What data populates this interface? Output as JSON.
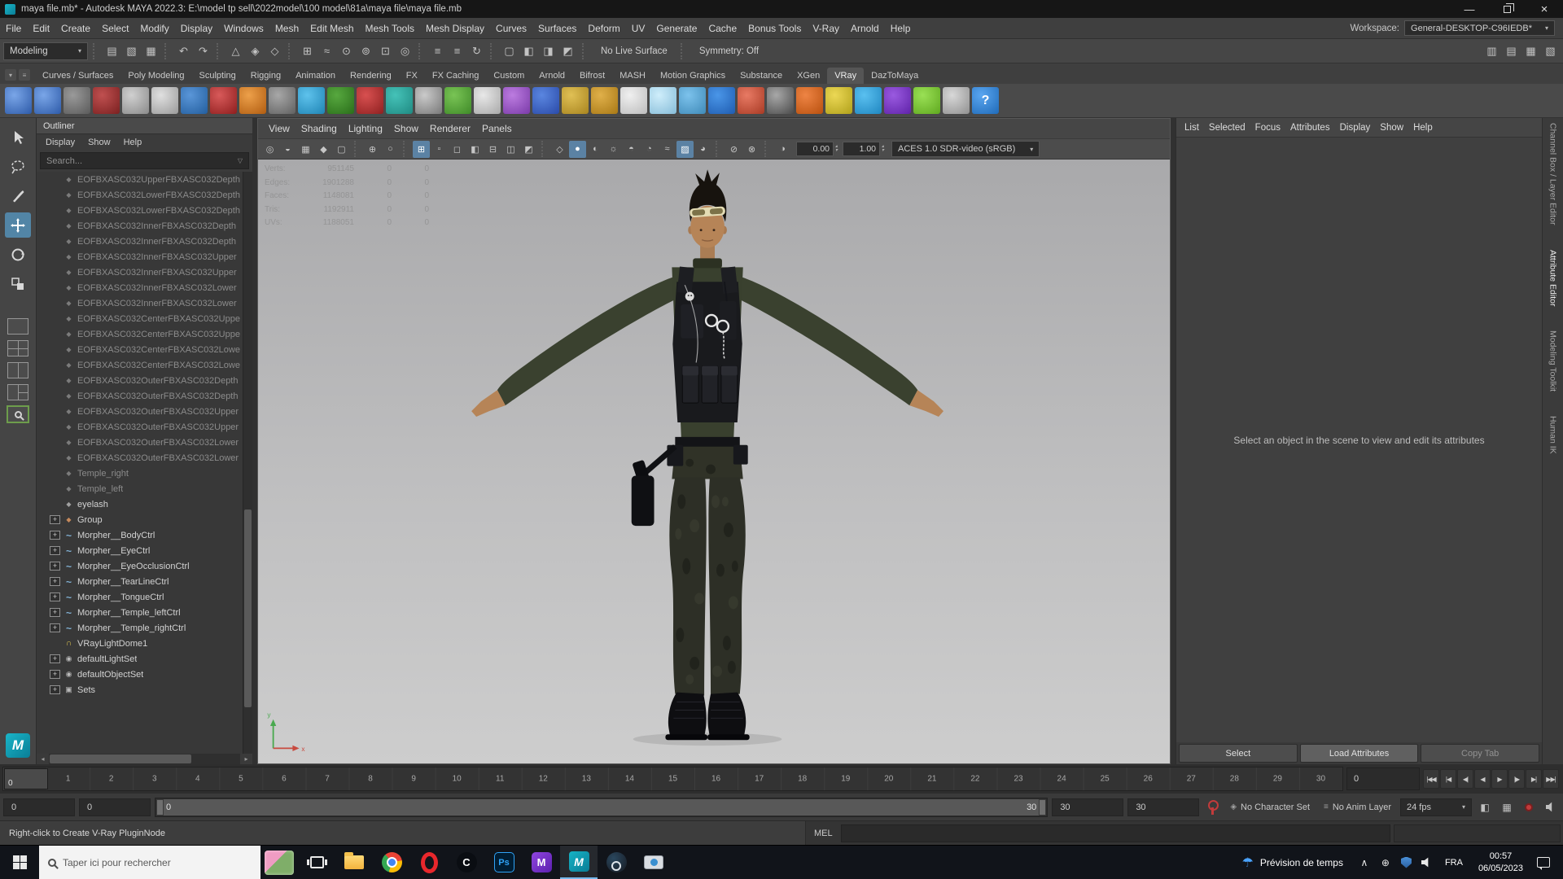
{
  "window": {
    "title": "maya file.mb* - Autodesk MAYA 2022.3: E:\\model tp sell\\2022model\\100 model\\81a\\maya file\\maya file.mb",
    "minimize": "—",
    "close": "×"
  },
  "menubar": {
    "items": [
      "File",
      "Edit",
      "Create",
      "Select",
      "Modify",
      "Display",
      "Windows",
      "Mesh",
      "Edit Mesh",
      "Mesh Tools",
      "Mesh Display",
      "Curves",
      "Surfaces",
      "Deform",
      "UV",
      "Generate",
      "Cache",
      "Bonus Tools",
      "V-Ray",
      "Arnold",
      "Help"
    ]
  },
  "workspace": {
    "label": "Workspace:",
    "value": "General-DESKTOP-C96IEDB*"
  },
  "toolbar": {
    "menuset": "Modeling",
    "no_live_surface": "No Live Surface",
    "symmetry": "Symmetry: Off",
    "icons": [
      {
        "sep": true
      },
      {
        "name": "file-new-icon",
        "glyph": "▤"
      },
      {
        "name": "file-open-icon",
        "glyph": "▧"
      },
      {
        "name": "file-save-icon",
        "glyph": "▦"
      },
      {
        "sep": true
      },
      {
        "name": "undo-icon",
        "glyph": "↶"
      },
      {
        "name": "redo-icon",
        "glyph": "↷"
      },
      {
        "sep": true
      },
      {
        "name": "select-hierarchy-icon",
        "glyph": "△"
      },
      {
        "name": "select-object-icon",
        "glyph": "◈"
      },
      {
        "name": "select-component-icon",
        "glyph": "◇"
      },
      {
        "sep": true
      },
      {
        "name": "snap-grid-icon",
        "glyph": "⊞"
      },
      {
        "name": "snap-curve-icon",
        "glyph": "≈"
      },
      {
        "name": "snap-point-icon",
        "glyph": "⊙"
      },
      {
        "name": "snap-projected-center-icon",
        "glyph": "⊚"
      },
      {
        "name": "snap-view-plane-icon",
        "glyph": "⊡"
      },
      {
        "name": "make-live-icon",
        "glyph": "◎"
      },
      {
        "sep": true
      },
      {
        "name": "input-connections-icon",
        "glyph": "≡"
      },
      {
        "name": "output-connections-icon",
        "glyph": "≡"
      },
      {
        "name": "construction-history-icon",
        "glyph": "↻"
      },
      {
        "sep": true
      },
      {
        "name": "render-view-icon",
        "glyph": "▢"
      },
      {
        "name": "render-current-frame-icon",
        "glyph": "◧"
      },
      {
        "name": "ipr-render-icon",
        "glyph": "◨"
      },
      {
        "name": "render-settings-icon",
        "glyph": "◩"
      }
    ],
    "right_icons": [
      {
        "name": "toggle-attribute-editor-icon",
        "glyph": "▥"
      },
      {
        "name": "toggle-tool-settings-icon",
        "glyph": "▤"
      },
      {
        "name": "toggle-channel-box-icon",
        "glyph": "▦"
      },
      {
        "name": "workspace-panel-icon",
        "glyph": "▧"
      }
    ]
  },
  "shelf": {
    "tabs": [
      "Curves / Surfaces",
      "Poly Modeling",
      "Sculpting",
      "Rigging",
      "Animation",
      "Rendering",
      "FX",
      "FX Caching",
      "Custom",
      "Arnold",
      "Bifrost",
      "MASH",
      "Motion Graphics",
      "Substance",
      "XGen",
      "VRay",
      "DazToMaya"
    ],
    "active_tab": "VRay",
    "icons": [
      {
        "name": "cv-curve-icon",
        "c1": "#7aa6e8",
        "c2": "#2d5aa8"
      },
      {
        "name": "ep-curve-icon",
        "c1": "#7aa6e8",
        "c2": "#2d5aa8"
      },
      {
        "name": "pencil-curve-icon",
        "c1": "#9a9a9a",
        "c2": "#5a5a5a"
      },
      {
        "name": "arc-tool-icon",
        "c1": "#c05050",
        "c2": "#7a2020"
      },
      {
        "name": "sphere-icon",
        "c1": "#d0d0d0",
        "c2": "#8a8a8a"
      },
      {
        "name": "cube-icon",
        "c1": "#e0e0e0",
        "c2": "#9a9a9a"
      },
      {
        "name": "character-icon",
        "c1": "#5a96d8",
        "c2": "#235e9e"
      },
      {
        "name": "red-sphere-icon",
        "c1": "#d85a5a",
        "c2": "#8e1d1d"
      },
      {
        "name": "fire-fx-icon",
        "c1": "#eda04a",
        "c2": "#b05c10"
      },
      {
        "name": "camera-icon",
        "c1": "#a8a8a8",
        "c2": "#606060"
      },
      {
        "name": "fluid-drop-icon",
        "c1": "#5ec2ec",
        "c2": "#1f84b4"
      },
      {
        "name": "tree-icon",
        "c1": "#57a83f",
        "c2": "#2a6e1a"
      },
      {
        "name": "apple-icon",
        "c1": "#d85050",
        "c2": "#8e2020"
      },
      {
        "name": "paint-brush-icon",
        "c1": "#45c2b8",
        "c2": "#1f8a82"
      },
      {
        "name": "checker-sphere-icon",
        "c1": "#cacaca",
        "c2": "#787878"
      },
      {
        "name": "grass-icon",
        "c1": "#79c455",
        "c2": "#3f8a28"
      },
      {
        "name": "cone-icon",
        "c1": "#e8e8e8",
        "c2": "#a8a8a8"
      },
      {
        "name": "flower-icon",
        "c1": "#bc7ce0",
        "c2": "#7a3aa8"
      },
      {
        "name": "blue-sphere-icon",
        "c1": "#5a86e0",
        "c2": "#2a4aa8"
      },
      {
        "name": "gold-cone-icon",
        "c1": "#e0c055",
        "c2": "#a8841f"
      },
      {
        "name": "gold-sphere-icon",
        "c1": "#e0b04a",
        "c2": "#a87815"
      },
      {
        "name": "white-cone-icon",
        "c1": "#f0f0f0",
        "c2": "#bcbcbc"
      },
      {
        "name": "snowflake-icon",
        "c1": "#cfeefb",
        "c2": "#86bcd8"
      },
      {
        "name": "glass-pane-icon",
        "c1": "#7cc2ec",
        "c2": "#3f8ab8"
      },
      {
        "name": "shaded-ball-icon",
        "c1": "#4a96e8",
        "c2": "#1f5cb0"
      },
      {
        "name": "half-sphere-icon",
        "c1": "#e87a64",
        "c2": "#a83a24"
      },
      {
        "name": "checker-cube-icon",
        "c1": "#a8a8a8",
        "c2": "#4a4a4a"
      },
      {
        "name": "orange-ball-icon",
        "c1": "#ee8444",
        "c2": "#b8500e"
      },
      {
        "name": "measure-icon",
        "c1": "#ecd855",
        "c2": "#b0a01a"
      },
      {
        "name": "daz-cloud-icon",
        "c1": "#5ac0f0",
        "c2": "#1f86c0"
      },
      {
        "name": "purple-sphere-icon",
        "c1": "#9a5ae0",
        "c2": "#5f22a8"
      },
      {
        "name": "green-ball-icon",
        "c1": "#9ae055",
        "c2": "#5fa81f"
      },
      {
        "name": "gray-sphere-icon",
        "c1": "#d8d8d8",
        "c2": "#909090"
      },
      {
        "name": "help-icon",
        "c1": "#5aa6f0",
        "c2": "#1f6ab8",
        "glyph": "?"
      }
    ]
  },
  "icon_glyphs": {
    "transform": "◆",
    "curve": "~",
    "group": "◆",
    "dome": "∩",
    "set": "◉",
    "sets": "▣"
  },
  "outliner": {
    "title": "Outliner",
    "menus": [
      "Display",
      "Show",
      "Help"
    ],
    "search_placeholder": "Search...",
    "items": [
      {
        "label": "EOFBXASC032UpperFBXASC032Depth",
        "icon": "transform",
        "dim": true,
        "expand": false
      },
      {
        "label": "EOFBXASC032LowerFBXASC032Depth",
        "icon": "transform",
        "dim": true,
        "expand": false
      },
      {
        "label": "EOFBXASC032LowerFBXASC032Depth",
        "icon": "transform",
        "dim": true,
        "expand": false
      },
      {
        "label": "EOFBXASC032InnerFBXASC032Depth",
        "icon": "transform",
        "dim": true,
        "expand": false
      },
      {
        "label": "EOFBXASC032InnerFBXASC032Depth",
        "icon": "transform",
        "dim": true,
        "expand": false
      },
      {
        "label": "EOFBXASC032InnerFBXASC032Upper",
        "icon": "transform",
        "dim": true,
        "expand": false
      },
      {
        "label": "EOFBXASC032InnerFBXASC032Upper",
        "icon": "transform",
        "dim": true,
        "expand": false
      },
      {
        "label": "EOFBXASC032InnerFBXASC032Lower",
        "icon": "transform",
        "dim": true,
        "expand": false
      },
      {
        "label": "EOFBXASC032InnerFBXASC032Lower",
        "icon": "transform",
        "dim": true,
        "expand": false
      },
      {
        "label": "EOFBXASC032CenterFBXASC032Uppe",
        "icon": "transform",
        "dim": true,
        "expand": false
      },
      {
        "label": "EOFBXASC032CenterFBXASC032Uppe",
        "icon": "transform",
        "dim": true,
        "expand": false
      },
      {
        "label": "EOFBXASC032CenterFBXASC032Lowe",
        "icon": "transform",
        "dim": true,
        "expand": false
      },
      {
        "label": "EOFBXASC032CenterFBXASC032Lowe",
        "icon": "transform",
        "dim": true,
        "expand": false
      },
      {
        "label": "EOFBXASC032OuterFBXASC032Depth",
        "icon": "transform",
        "dim": true,
        "expand": false
      },
      {
        "label": "EOFBXASC032OuterFBXASC032Depth",
        "icon": "transform",
        "dim": true,
        "expand": false
      },
      {
        "label": "EOFBXASC032OuterFBXASC032Upper",
        "icon": "transform",
        "dim": true,
        "expand": false
      },
      {
        "label": "EOFBXASC032OuterFBXASC032Upper",
        "icon": "transform",
        "dim": true,
        "expand": false
      },
      {
        "label": "EOFBXASC032OuterFBXASC032Lower",
        "icon": "transform",
        "dim": true,
        "expand": false
      },
      {
        "label": "EOFBXASC032OuterFBXASC032Lower",
        "icon": "transform",
        "dim": true,
        "expand": false
      },
      {
        "label": "Temple_right",
        "icon": "transform",
        "dim": true,
        "expand": false
      },
      {
        "label": "Temple_left",
        "icon": "transform",
        "dim": true,
        "expand": false
      },
      {
        "label": "eyelash",
        "icon": "transform",
        "dim": false,
        "expand": false
      },
      {
        "label": "Group",
        "icon": "group",
        "dim": false,
        "expand": true
      },
      {
        "label": "Morpher__BodyCtrl",
        "icon": "curve",
        "dim": false,
        "expand": true
      },
      {
        "label": "Morpher__EyeCtrl",
        "icon": "curve",
        "dim": false,
        "expand": true
      },
      {
        "label": "Morpher__EyeOcclusionCtrl",
        "icon": "curve",
        "dim": false,
        "expand": true
      },
      {
        "label": "Morpher__TearLineCtrl",
        "icon": "curve",
        "dim": false,
        "expand": true
      },
      {
        "label": "Morpher__TongueCtrl",
        "icon": "curve",
        "dim": false,
        "expand": true
      },
      {
        "label": "Morpher__Temple_leftCtrl",
        "icon": "curve",
        "dim": false,
        "expand": true
      },
      {
        "label": "Morpher__Temple_rightCtrl",
        "icon": "curve",
        "dim": false,
        "expand": true
      },
      {
        "label": "VRayLightDome1",
        "icon": "dome",
        "dim": false,
        "expand": false
      },
      {
        "label": "defaultLightSet",
        "icon": "set",
        "dim": false,
        "expand": true
      },
      {
        "label": "defaultObjectSet",
        "icon": "set",
        "dim": false,
        "expand": true
      },
      {
        "label": "Sets",
        "icon": "sets",
        "dim": false,
        "expand": true
      }
    ]
  },
  "viewport": {
    "menus": [
      "View",
      "Shading",
      "Lighting",
      "Show",
      "Renderer",
      "Panels"
    ],
    "icons": [
      {
        "name": "select-camera-icon",
        "glyph": "◎"
      },
      {
        "name": "lock-camera-icon",
        "glyph": "◒"
      },
      {
        "name": "camera-attributes-icon",
        "glyph": "▦"
      },
      {
        "name": "bookmarks-icon",
        "glyph": "◆"
      },
      {
        "name": "image-plane-icon",
        "glyph": "▢"
      },
      {
        "sep": true
      },
      {
        "name": "pan-zoom-2d-icon",
        "glyph": "⊕"
      },
      {
        "name": "oversampling-icon",
        "glyph": "○"
      },
      {
        "sep": true
      },
      {
        "name": "grid-toggle-icon",
        "glyph": "⊞",
        "active": true
      },
      {
        "name": "film-gate-icon",
        "glyph": "▫"
      },
      {
        "name": "resolution-gate-icon",
        "glyph": "◻"
      },
      {
        "name": "gate-mask-icon",
        "glyph": "◧"
      },
      {
        "name": "field-chart-icon",
        "glyph": "⊟"
      },
      {
        "name": "safe-action-icon",
        "glyph": "◫"
      },
      {
        "name": "safe-title-icon",
        "glyph": "◩"
      },
      {
        "sep": true
      },
      {
        "name": "wireframe-icon",
        "glyph": "◇"
      },
      {
        "name": "shaded-icon",
        "glyph": "●",
        "active": true
      },
      {
        "name": "textured-icon",
        "glyph": "◐"
      },
      {
        "name": "lights-icon",
        "glyph": "☼"
      },
      {
        "name": "shadows-icon",
        "glyph": "◓"
      },
      {
        "name": "ssao-icon",
        "glyph": "◔"
      },
      {
        "name": "motion-blur-icon",
        "glyph": "≈"
      },
      {
        "name": "anti-alias-icon",
        "glyph": "▨",
        "active": true
      },
      {
        "name": "depth-of-field-icon",
        "glyph": "◕"
      },
      {
        "sep": true
      },
      {
        "name": "isolate-select-icon",
        "glyph": "⊘"
      },
      {
        "name": "xray-icon",
        "glyph": "⊗"
      },
      {
        "sep": true
      },
      {
        "name": "exposure-icon",
        "glyph": "◑"
      }
    ],
    "exposure": "0.00",
    "gamma": "1.00",
    "colorspace": "ACES 1.0 SDR-video (sRGB)",
    "hud": {
      "rows": [
        {
          "label": "Verts:",
          "value": "951145",
          "z1": "0",
          "z2": "0"
        },
        {
          "label": "Edges:",
          "value": "1901288",
          "z1": "0",
          "z2": "0"
        },
        {
          "label": "Faces:",
          "value": "1148081",
          "z1": "0",
          "z2": "0"
        },
        {
          "label": "Tris:",
          "value": "1192911",
          "z1": "0",
          "z2": "0"
        },
        {
          "label": "UVs:",
          "value": "1188051",
          "z1": "0",
          "z2": "0"
        }
      ]
    }
  },
  "attribute_editor": {
    "menus": [
      "List",
      "Selected",
      "Focus",
      "Attributes",
      "Display",
      "Show",
      "Help"
    ],
    "message": "Select an object in the scene to view and edit its attributes",
    "buttons": [
      {
        "label": "Select"
      },
      {
        "label": "Load Attributes",
        "primary": true
      },
      {
        "label": "Copy Tab",
        "dim": true
      }
    ]
  },
  "side_tabs": {
    "items": [
      "Channel Box / Layer Editor",
      "Attribute Editor",
      "Modeling Toolkit",
      "Human IK"
    ],
    "active": "Attribute Editor"
  },
  "timeline": {
    "ticks": [
      1,
      2,
      3,
      4,
      5,
      6,
      7,
      8,
      9,
      10,
      11,
      12,
      13,
      14,
      15,
      16,
      17,
      18,
      19,
      20,
      21,
      22,
      23,
      24,
      25,
      26,
      27,
      28,
      29,
      30
    ],
    "current_frame": "0",
    "current_time_field": "0",
    "playback": [
      {
        "name": "go-to-start-button",
        "glyph": "|◀◀"
      },
      {
        "name": "step-back-frame-button",
        "glyph": "|◀"
      },
      {
        "name": "step-back-key-button",
        "glyph": "◀|"
      },
      {
        "name": "play-backwards-button",
        "glyph": "◀"
      },
      {
        "name": "play-forwards-button",
        "glyph": "▶"
      },
      {
        "name": "step-forward-key-button",
        "glyph": "|▶"
      },
      {
        "name": "step-forward-frame-button",
        "glyph": "▶|"
      },
      {
        "name": "go-to-end-button",
        "glyph": "▶▶|"
      }
    ]
  },
  "range_slider": {
    "anim_start": "0",
    "playback_start": "0",
    "bar_start_label": "0",
    "bar_end_label": "30",
    "playback_end": "30",
    "anim_end": "30",
    "character_set": "No Character Set",
    "anim_layer": "No Anim Layer",
    "fps": "24 fps"
  },
  "command_line": {
    "help_text": "Right-click to Create V-Ray PluginNode",
    "label": "MEL"
  },
  "branding": {
    "maya_logo_text": "M"
  },
  "taskbar": {
    "search_placeholder": "Taper ici pour rechercher",
    "app_labels": {
      "c": "C",
      "ps": "Ps",
      "m": "M",
      "maya": "M"
    },
    "tray": {
      "weather": "Prévision de temps",
      "lang": "FRA",
      "time": "00:57",
      "date": "06/05/2023"
    }
  }
}
